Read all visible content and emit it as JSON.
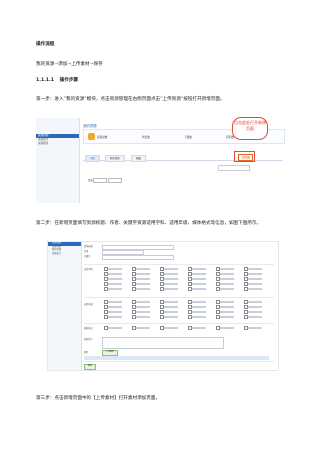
{
  "doc": {
    "section_heading": "操作流程",
    "path_line": "我的资源→添加→上传素材→保存",
    "subsection_number": "1.1.1.1",
    "subsection_title": "操作步骤",
    "step1": "第一步：进入“我的资源”模块，点击资源管理在右侧页面点击“上传资源”按钮打开新增页面。",
    "step2": "第二步：在新增页面填写资源标题、作者、关键字资源适用学科、适用年级、媒体格式等信息，如图下图所示。",
    "step3": "第三步：点击新增页面中的【上传素材】打开素材添加页面。"
  },
  "screenshot1": {
    "page_title": "我的资源",
    "callout_text": "点击此处打开新增页面",
    "sidebar_items": [
      "资源管理",
      "资源统计",
      "资源检索"
    ],
    "sidebar_active": "资源管理",
    "stat_labels": [
      "资源总数",
      "浏览数",
      "下载数",
      "评论数"
    ],
    "tabs": [
      "全部",
      "我的资源",
      "收藏"
    ],
    "upload_label": "上传资源",
    "filter_label": "筛选"
  },
  "screenshot2": {
    "sidebar_header": "资源管理",
    "sidebar_items": [
      "资源列表",
      "我的资源",
      "资源统计"
    ],
    "form_labels": [
      "资源标题",
      "作者",
      "关键字",
      "适用学科",
      "适用年级",
      "媒体格式",
      "资源简介",
      "附件"
    ],
    "buttons": [
      "上传素材",
      "保存"
    ]
  },
  "colors": {
    "accent_blue": "#2b6cb8",
    "callout_red": "#e24a3a",
    "stat_orange": "#f0a830"
  }
}
